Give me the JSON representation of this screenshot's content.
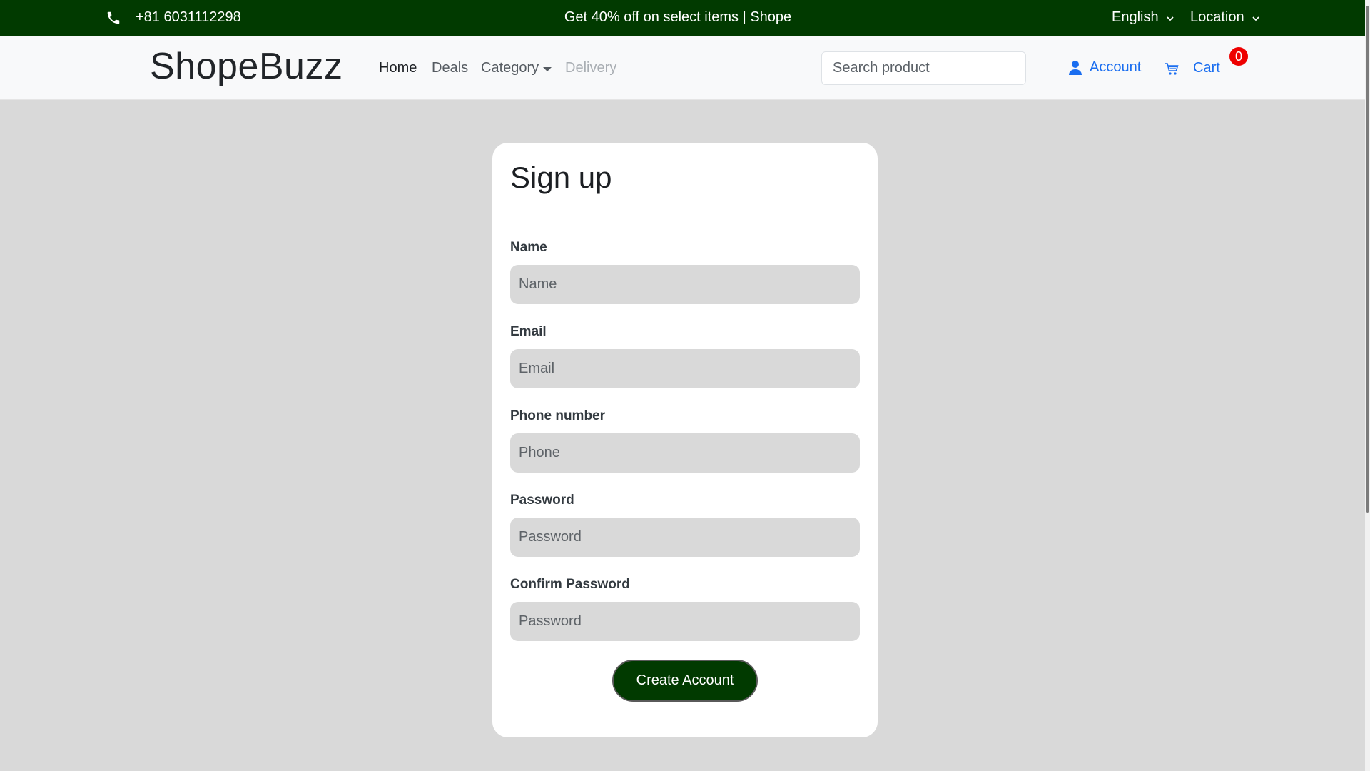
{
  "topbar": {
    "phone": "+81 6031112298",
    "promo": "Get 40% off on select items | Shope",
    "language": "English",
    "location": "Location"
  },
  "navbar": {
    "brand": "ShopeBuzz",
    "links": {
      "home": "Home",
      "deals": "Deals",
      "category": "Category",
      "delivery": "Delivery"
    },
    "search_placeholder": "Search product",
    "account": "Account",
    "cart": "Cart",
    "cart_count": "0"
  },
  "signup": {
    "title": "Sign up",
    "fields": [
      {
        "label": "Name",
        "placeholder": "Name"
      },
      {
        "label": "Email",
        "placeholder": "Email"
      },
      {
        "label": "Phone number",
        "placeholder": "Phone"
      },
      {
        "label": "Password",
        "placeholder": "Password"
      },
      {
        "label": "Confirm Password",
        "placeholder": "Password"
      }
    ],
    "submit_label": "Create Account"
  },
  "colors": {
    "topbar_bg": "#013a00",
    "accent_link": "#1a6ef0",
    "badge": "#ee0000",
    "page_bg": "#d9d9d9"
  }
}
